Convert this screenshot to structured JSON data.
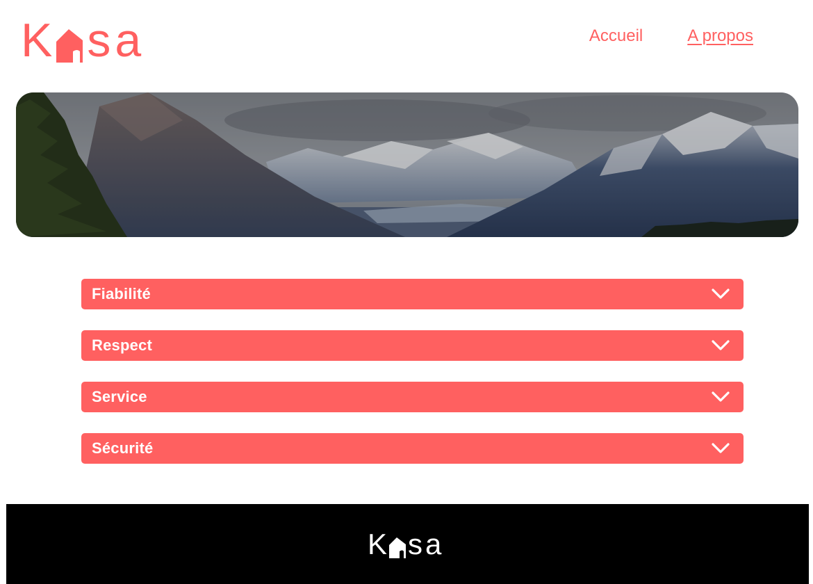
{
  "brand": {
    "logo_first": "K",
    "logo_rest": "sa",
    "logo_icon": "house-icon",
    "color": "#ff6060"
  },
  "nav": {
    "items": [
      {
        "label": "Accueil",
        "active": false
      },
      {
        "label": "A propos",
        "active": true
      }
    ]
  },
  "banner": {
    "image": "mountain-landscape"
  },
  "collapses": [
    {
      "title": "Fiabilité",
      "icon": "chevron-down-icon"
    },
    {
      "title": "Respect",
      "icon": "chevron-down-icon"
    },
    {
      "title": "Service",
      "icon": "chevron-down-icon"
    },
    {
      "title": "Sécurité",
      "icon": "chevron-down-icon"
    }
  ],
  "footer": {
    "logo_first": "K",
    "logo_rest": "sa",
    "background": "#000000"
  }
}
